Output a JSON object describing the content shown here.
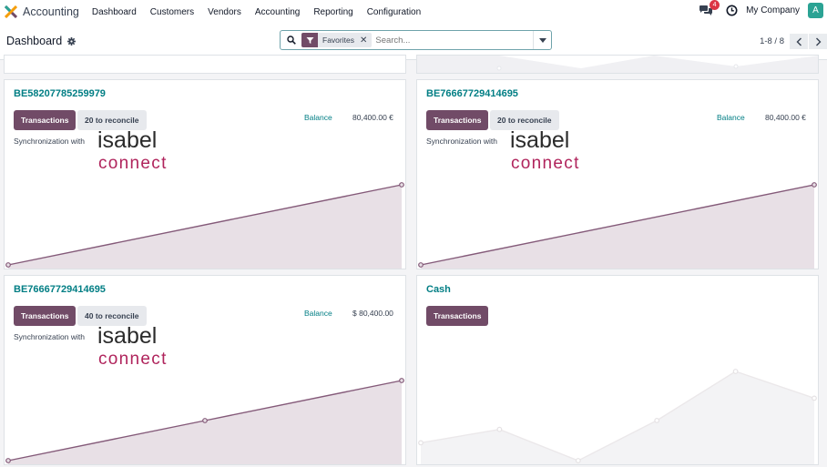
{
  "app": {
    "name": "Accounting",
    "menu": [
      "Dashboard",
      "Customers",
      "Vendors",
      "Accounting",
      "Reporting",
      "Configuration"
    ],
    "messages_count": "4",
    "company": "My Company",
    "avatar_initial": "A",
    "brand_colors": {
      "primary": "#714b67",
      "teal": "#017e84",
      "logo_green": "#2ba394",
      "badge": "#dc3545"
    }
  },
  "control_panel": {
    "title": "Dashboard",
    "search_facet": "Favorites",
    "search_placeholder": "Search...",
    "pager": "1-8 / 8"
  },
  "cards": [
    {
      "title": "BE58207785259979",
      "button_transactions": "Transactions",
      "button_reconcile": "20 to reconcile",
      "balance_label": "Balance",
      "balance_value": "80,400.00 €",
      "sync_text": "Synchronization with",
      "logo": [
        "isabel",
        "connect"
      ],
      "graph": [
        0,
        100
      ]
    },
    {
      "title": "BE76667729414695",
      "button_transactions": "Transactions",
      "button_reconcile": "20 to reconcile",
      "balance_label": "Balance",
      "balance_value": "80,400.00 €",
      "sync_text": "Synchronization with",
      "logo": [
        "isabel",
        "connect"
      ],
      "graph": [
        0,
        100
      ]
    },
    {
      "title": "BE76667729414695",
      "button_transactions": "Transactions",
      "button_reconcile": "40 to reconcile",
      "balance_label": "Balance",
      "balance_value": "$ 80,400.00",
      "sync_text": "Synchronization with",
      "logo": [
        "isabel",
        "connect"
      ],
      "graph": [
        0,
        50,
        100
      ]
    },
    {
      "title": "Cash",
      "button_transactions": "Transactions",
      "graph": [
        20,
        35,
        0,
        45,
        100,
        70
      ]
    }
  ]
}
